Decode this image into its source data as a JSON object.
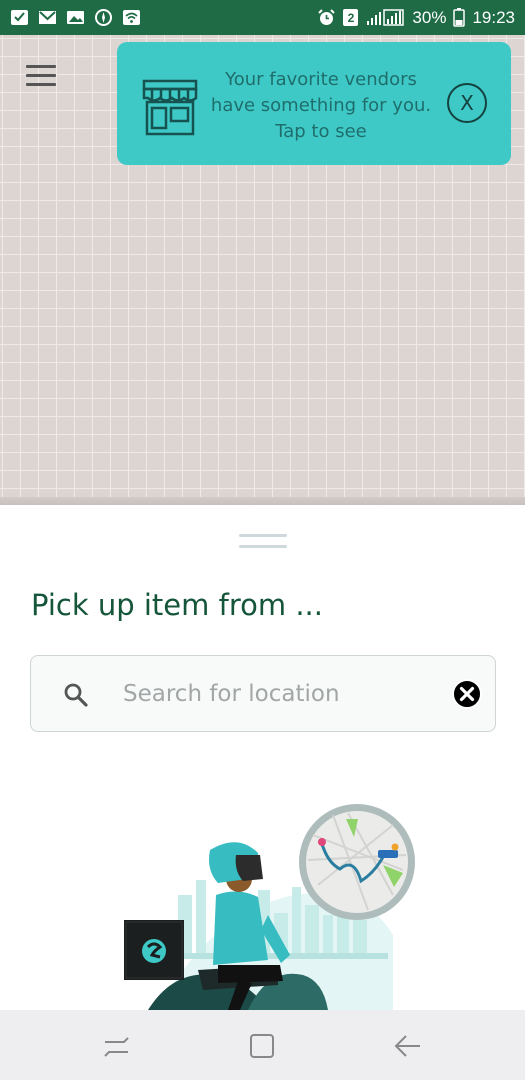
{
  "status_bar": {
    "left_icons": [
      "checkbox-icon",
      "gmail-icon",
      "gallery-icon",
      "compass-icon",
      "wifi-icon"
    ],
    "right_icons": [
      "alarm-icon",
      "sim-icon",
      "signal-icon",
      "battery-icon"
    ],
    "sim_slot": "2",
    "battery": "30%",
    "time": "19:23"
  },
  "map": {
    "menu_icon": "hamburger-menu-icon"
  },
  "banner": {
    "icon": "store-icon",
    "text": "Your favorite vendors\nhave something for you.\nTap to see",
    "close_label": "X"
  },
  "sheet": {
    "title": "Pick up item from ...",
    "search": {
      "icon": "search-icon",
      "placeholder": "Search for location",
      "value": "",
      "clear_icon": "clear-icon"
    },
    "illustration": "courier-rider-map-illustration"
  },
  "nav_bar": {
    "items": [
      "recents-icon",
      "home-icon",
      "back-icon"
    ]
  },
  "colors": {
    "status_bar": "#1e6b46",
    "map_bg": "#ddd5d2",
    "banner_bg": "#3ec9c7",
    "banner_text": "#1f6e6c",
    "title": "#15553a",
    "accent_teal": "#3ec9c7",
    "nav_bar": "#eeeef0"
  }
}
